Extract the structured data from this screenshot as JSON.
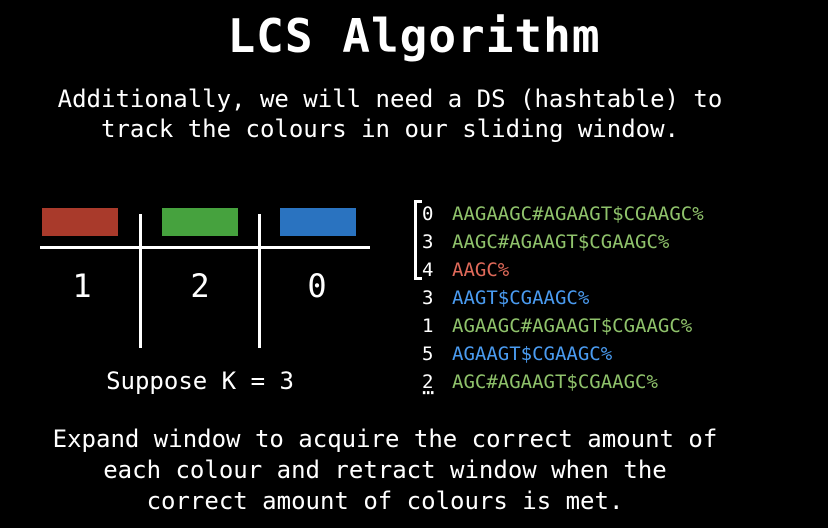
{
  "title": "LCS Algorithm",
  "intro_text": "Additionally, we will need a DS (hashtable) to\ntrack the colours in our sliding window.",
  "colour_table": {
    "colours": [
      {
        "name": "red",
        "hex": "#a93a2b",
        "count": "1"
      },
      {
        "name": "green",
        "hex": "#46a23e",
        "count": "2"
      },
      {
        "name": "blue",
        "hex": "#2a73c0",
        "count": "0"
      }
    ]
  },
  "suppose_text": "Suppose K = 3",
  "suffixes": [
    {
      "index": "0",
      "text": "AAGAAGC#AGAAGT$CGAAGC%",
      "color": "#8fc26b"
    },
    {
      "index": "3",
      "text": "AAGC#AGAAGT$CGAAGC%",
      "color": "#8fc26b"
    },
    {
      "index": "4",
      "text": "AAGC%",
      "color": "#e06a5a"
    },
    {
      "index": "3",
      "text": "AAGT$CGAAGC%",
      "color": "#4a9bf0"
    },
    {
      "index": "1",
      "text": "AGAAGC#AGAAGT$CGAAGC%",
      "color": "#8fc26b"
    },
    {
      "index": "5",
      "text": "AGAAGT$CGAAGC%",
      "color": "#4a9bf0"
    },
    {
      "index": "2",
      "text": "AGC#AGAAGT$CGAAGC%",
      "color": "#8fc26b"
    }
  ],
  "ellipsis": "⋯",
  "outro_text": "Expand window to acquire the correct amount of\neach colour and retract window when the\ncorrect amount of colours is met."
}
